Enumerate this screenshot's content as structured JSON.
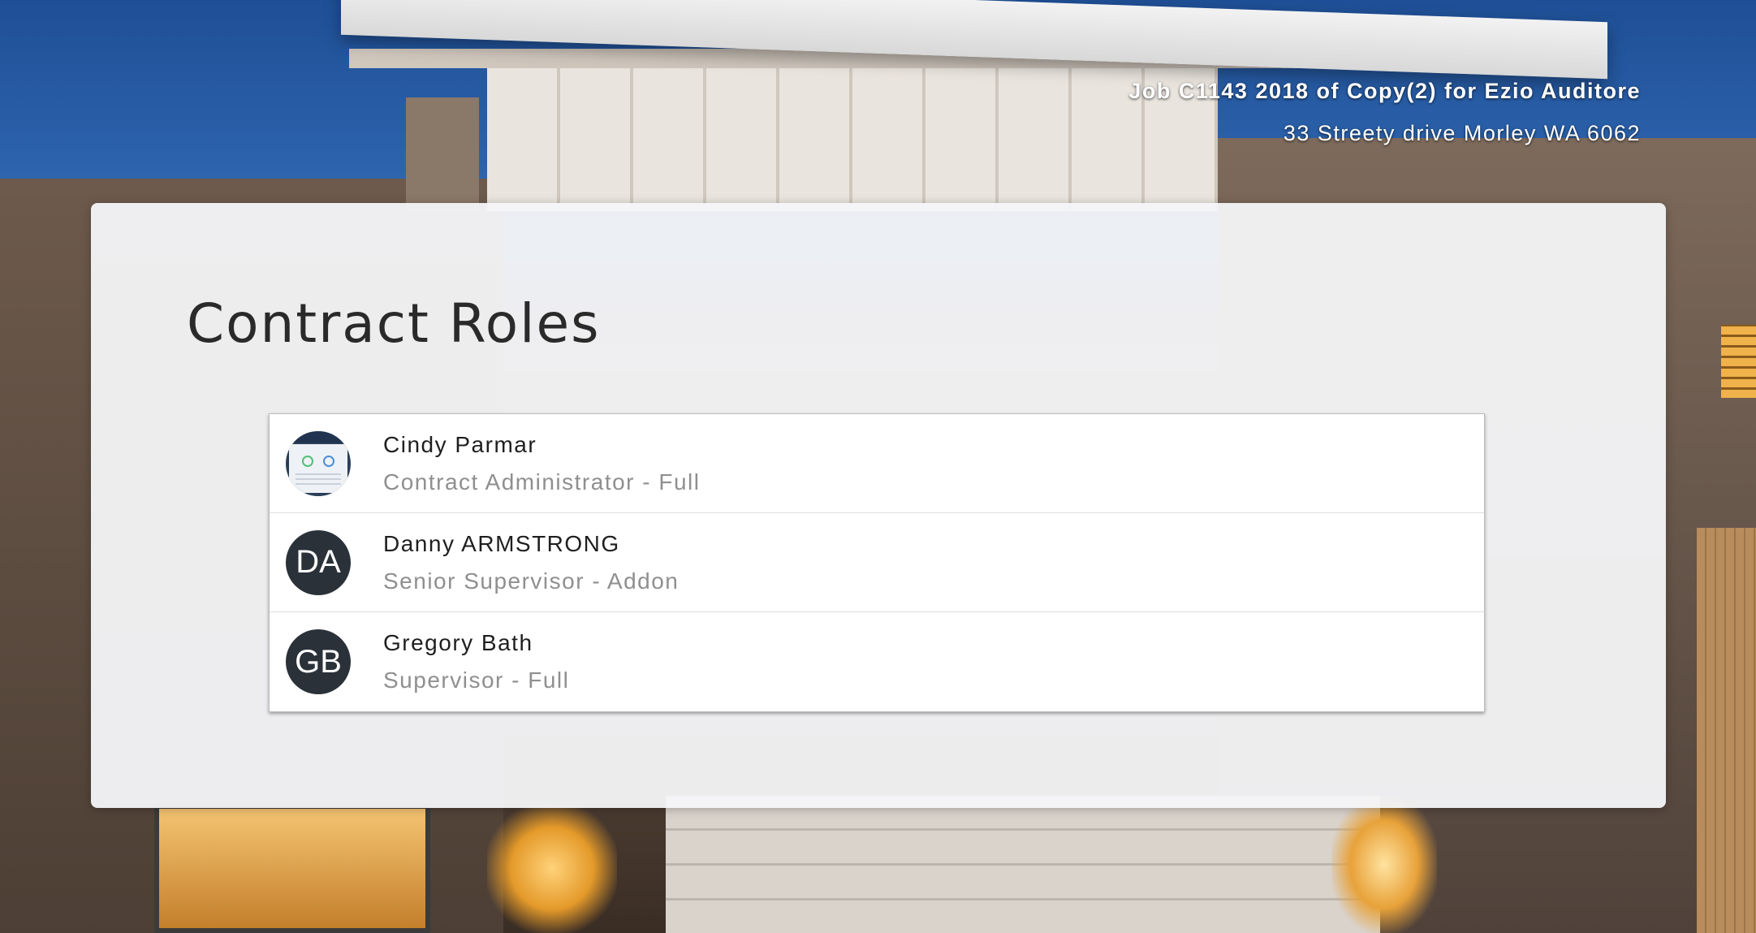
{
  "header": {
    "job_title": "Job C1143 2018 of Copy(2) for Ezio Auditore",
    "address": "33 Streety drive Morley WA 6062"
  },
  "main": {
    "title": "Contract Roles",
    "roles": [
      {
        "name": "Cindy Parmar",
        "role": "Contract Administrator - Full",
        "avatar_type": "photo",
        "initials": ""
      },
      {
        "name": "Danny ARMSTRONG",
        "role": "Senior Supervisor - Addon",
        "avatar_type": "initials",
        "initials": "DA"
      },
      {
        "name": "Gregory Bath",
        "role": "Supervisor - Full",
        "avatar_type": "initials",
        "initials": "GB"
      }
    ]
  },
  "colors": {
    "avatar_bg": "#2b3139",
    "panel_bg": "#f5f5f8",
    "secondary_text": "#8f8f8f"
  }
}
